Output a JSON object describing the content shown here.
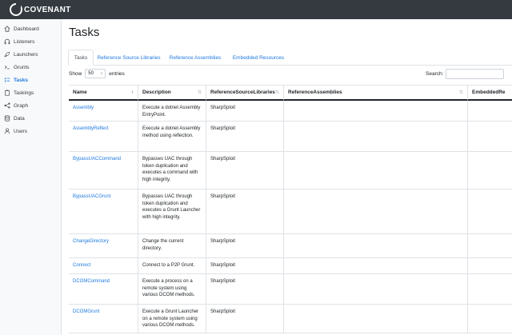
{
  "brand": {
    "name": "COVENANT"
  },
  "sidebar": {
    "items": [
      {
        "label": "Dashboard",
        "icon": "home-icon"
      },
      {
        "label": "Listeners",
        "icon": "headphones-icon"
      },
      {
        "label": "Launchers",
        "icon": "rocket-icon"
      },
      {
        "label": "Grunts",
        "icon": "terminal-icon"
      },
      {
        "label": "Tasks",
        "icon": "tasks-icon",
        "active": true
      },
      {
        "label": "Taskings",
        "icon": "clipboard-icon"
      },
      {
        "label": "Graph",
        "icon": "share-icon"
      },
      {
        "label": "Data",
        "icon": "database-icon"
      },
      {
        "label": "Users",
        "icon": "user-icon"
      }
    ]
  },
  "page": {
    "title": "Tasks"
  },
  "tabs": [
    {
      "label": "Tasks",
      "active": true
    },
    {
      "label": "Reference Source Libraries"
    },
    {
      "label": "Reference Assemblies"
    },
    {
      "label": "Embedded Resources"
    }
  ],
  "table_controls": {
    "show_label": "Show",
    "page_length": "50",
    "entries_label": "entries",
    "search_label": "Search:"
  },
  "table": {
    "columns": [
      "Name",
      "Description",
      "ReferenceSourceLibraries",
      "ReferenceAssemblies",
      "EmbeddedRe"
    ],
    "rows": [
      {
        "name": "Assembly",
        "description": "Execute a dotnet Assembly EntryPoint.",
        "libs": "SharpSploit"
      },
      {
        "name": "AssemblyReflect",
        "description": "Execute a dotnet Assembly method using reflection.",
        "libs": "SharpSploit"
      },
      {
        "name": "BypassUACCommand",
        "description": "Bypasses UAC through token duplication and executes a command with high integrity.",
        "libs": "SharpSploit"
      },
      {
        "name": "BypassUACGrunt",
        "description": "Bypasses UAC through token duplication and executes a Grunt Launcher with high integrity.",
        "libs": "SharpSploit"
      },
      {
        "name": "ChangeDirectory",
        "description": "Change the current directory.",
        "libs": "SharpSploit"
      },
      {
        "name": "Connect",
        "description": "Connect to a P2P Grunt.",
        "libs": "SharpSploit"
      },
      {
        "name": "DCOMCommand",
        "description": "Execute a process on a remote system using various DCOM methods.",
        "libs": "SharpSploit"
      },
      {
        "name": "DCOMGrunt",
        "description": "Execute a Grunt Launcher on a remote system using various DCOM methods.",
        "libs": "SharpSploit"
      }
    ]
  }
}
